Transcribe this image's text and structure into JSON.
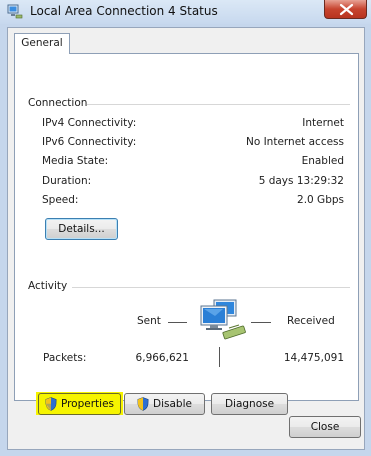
{
  "window": {
    "title": "Local Area Connection 4 Status"
  },
  "tabs": [
    {
      "label": "General"
    }
  ],
  "connection": {
    "group_label": "Connection",
    "rows": [
      {
        "label": "IPv4 Connectivity:",
        "value": "Internet"
      },
      {
        "label": "IPv6 Connectivity:",
        "value": "No Internet access"
      },
      {
        "label": "Media State:",
        "value": "Enabled"
      },
      {
        "label": "Duration:",
        "value": "5 days 13:29:32"
      },
      {
        "label": "Speed:",
        "value": "2.0 Gbps"
      }
    ],
    "details_button": "Details..."
  },
  "activity": {
    "group_label": "Activity",
    "sent_label": "Sent",
    "received_label": "Received",
    "packets_label": "Packets:",
    "packets_sent": "6,966,621",
    "packets_received": "14,475,091"
  },
  "buttons": {
    "properties": "Properties",
    "disable": "Disable",
    "diagnose": "Diagnose",
    "close": "Close"
  },
  "icons": {
    "app": "network-connection-icon",
    "activity": "network-computers-icon",
    "shield": "uac-shield-icon"
  },
  "colors": {
    "highlight": "#f6f400",
    "titlebar": "#c7d8ee",
    "close_button": "#c7442f"
  }
}
